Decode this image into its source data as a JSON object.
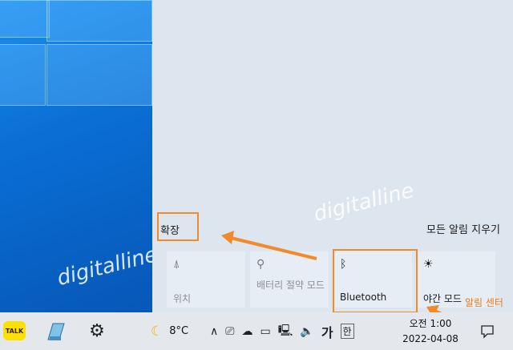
{
  "watermark": "digitalline",
  "action_center": {
    "expand_label": "확장",
    "clear_all_label": "모든 알림 지우기",
    "tiles": [
      {
        "label": "위치",
        "icon": "location-icon",
        "active": false
      },
      {
        "label": "배터리 절약 모드",
        "icon": "battery-saver-icon",
        "active": false
      },
      {
        "label": "Bluetooth",
        "icon": "bluetooth-icon",
        "active": true
      },
      {
        "label": "야간 모드",
        "icon": "night-light-icon",
        "active": true
      }
    ]
  },
  "annotation": {
    "callout": "알림 센터",
    "color": "#f08a2c"
  },
  "taskbar": {
    "kakao_label": "TALK",
    "weather": "8°C",
    "ime_hangul": "가",
    "ime_han": "한",
    "clock": {
      "line1": "오전 1:00",
      "line2": "2022-04-08"
    }
  }
}
